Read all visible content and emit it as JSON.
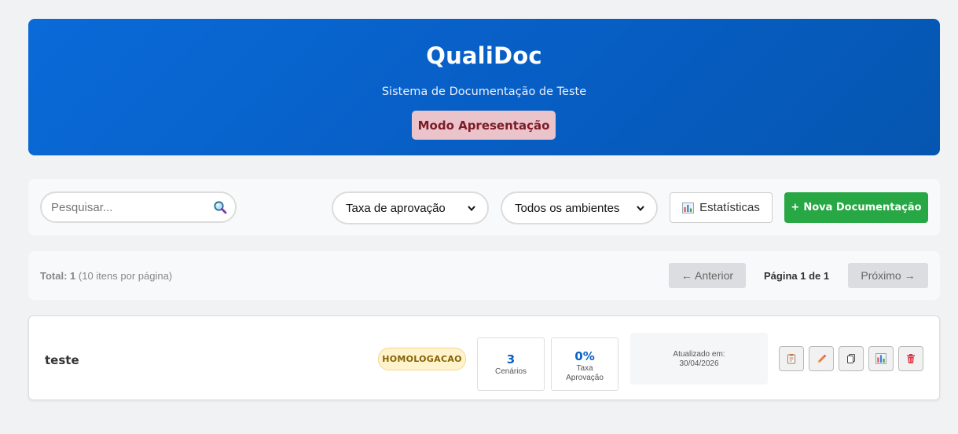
{
  "header": {
    "title": "QualiDoc",
    "subtitle": "Sistema de Documentação de Teste",
    "mode_button": "Modo Apresentação"
  },
  "toolbar": {
    "search_placeholder": "Pesquisar...",
    "search_icon": "magnifier-icon",
    "sort_select": {
      "selected": "Taxa de aprovação"
    },
    "env_select": {
      "selected": "Todos os ambientes"
    },
    "stats_button": "Estatísticas",
    "stats_icon": "bar-chart-icon",
    "new_button_plus": "+",
    "new_button": "Nova Documentação"
  },
  "pagination": {
    "total_label": "Total: 1",
    "per_page": "(10 itens por página)",
    "prev": "← Anterior",
    "page_label": "Página 1 de 1",
    "next": "Próximo →"
  },
  "documents": [
    {
      "title": "teste",
      "environment": "HOMOLOGACAO",
      "scenarios_value": "3",
      "scenarios_label": "Cenários",
      "rate_value": "0%",
      "rate_label_1": "Taxa",
      "rate_label_2": "Aprovação",
      "updated_label": "Atualizado em:",
      "updated_date": "30/04/2026",
      "actions": [
        "clipboard-icon",
        "pencil-icon",
        "copy-icon",
        "bar-chart-icon",
        "trash-icon"
      ]
    }
  ],
  "colors": {
    "header_blue": "#0a6ad8",
    "mode_bg": "#eac3cb",
    "mode_text": "#7d1c28",
    "success_green": "#28a745",
    "metric_blue": "#0b62c4",
    "badge_bg": "#fff3cd",
    "badge_text": "#856404",
    "danger_red": "#dc3545"
  }
}
